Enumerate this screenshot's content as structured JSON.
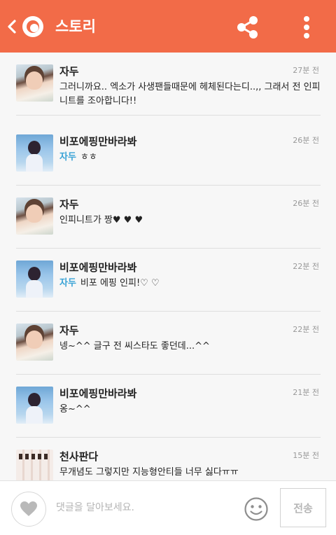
{
  "header": {
    "title": "스토리"
  },
  "comments": [
    {
      "author": "자두",
      "avatar": "avatar-photo-waving-girl",
      "time": "27분 전",
      "mention": "",
      "text": "그러니까요..  엑소가 사생팬들때문에 헤체된다는디..,, 그래서 전 인피니트를 조아합니다!!"
    },
    {
      "author": "비포에핑만바라봐",
      "avatar": "avatar-photo-singer",
      "time": "26분 전",
      "mention": "자두",
      "text": "ㅎㅎ"
    },
    {
      "author": "자두",
      "avatar": "avatar-photo-waving-girl",
      "time": "26분 전",
      "mention": "",
      "text": "인피니트가 짱♥ ♥ ♥"
    },
    {
      "author": "비포에핑만바라봐",
      "avatar": "avatar-photo-singer",
      "time": "22분 전",
      "mention": "자두",
      "text": "비포 에핑 인피!♡ ♡"
    },
    {
      "author": "자두",
      "avatar": "avatar-photo-waving-girl",
      "time": "22분 전",
      "mention": "",
      "text": "넹~^^   글구 전 씨스타도 좋던데...^^"
    },
    {
      "author": "비포에핑만바라봐",
      "avatar": "avatar-photo-singer",
      "time": "21분 전",
      "mention": "",
      "text": "옹~^^"
    },
    {
      "author": "천사판다",
      "avatar": "avatar-photo-group",
      "time": "15분 전",
      "mention": "",
      "text": "무개념도 그렇지만 지능형안티들 너무 싫다ㅠㅠ"
    }
  ],
  "input": {
    "placeholder": "댓글을 달아보세요.",
    "value": "",
    "send_label": "전송"
  },
  "icons": {
    "back": "chevron-left-icon",
    "logo": "kakaostory-logo",
    "share": "share-icon",
    "more": "more-vertical-icon",
    "like": "heart-icon",
    "emoji": "smiley-icon"
  },
  "colors": {
    "header": "#f26b48",
    "mention": "#3aa3d6",
    "background": "#f7f7f7"
  }
}
